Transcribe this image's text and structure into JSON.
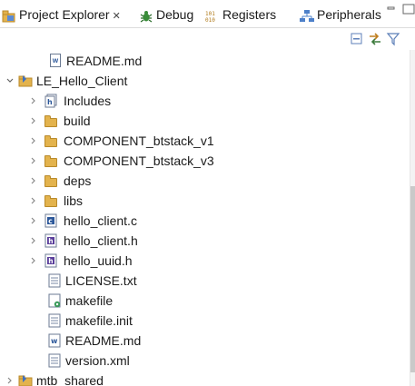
{
  "tabs": [
    {
      "label": "Project Explorer",
      "close": "✕",
      "icon": "project-explorer-icon",
      "active": true
    },
    {
      "label": "Debug",
      "icon": "debug-icon"
    },
    {
      "label": "Registers",
      "icon": "registers-icon"
    },
    {
      "label": "Peripherals",
      "icon": "peripherals-icon"
    }
  ],
  "toolbar": {
    "collapse_icon": "collapse-all-icon",
    "link_icon": "link-with-editor-icon",
    "filter_icon": "filter-icon"
  },
  "tree": {
    "readme_top": "README.md",
    "project": "LE_Hello_Client",
    "includes": "Includes",
    "build": "build",
    "comp_v1": "COMPONENT_btstack_v1",
    "comp_v3": "COMPONENT_btstack_v3",
    "deps": "deps",
    "libs": "libs",
    "hello_client_c": "hello_client.c",
    "hello_client_h": "hello_client.h",
    "hello_uuid_h": "hello_uuid.h",
    "license": "LICENSE.txt",
    "makefile": "makefile",
    "makefile_init": "makefile.init",
    "readme": "README.md",
    "version": "version.xml",
    "mtb_shared": "mtb_shared"
  },
  "colors": {
    "folder": "#e3b34d",
    "project": "#3e6fbf",
    "c_file": "#2b579a",
    "h_file": "#5a3e9b",
    "selection": "#ffffff"
  }
}
